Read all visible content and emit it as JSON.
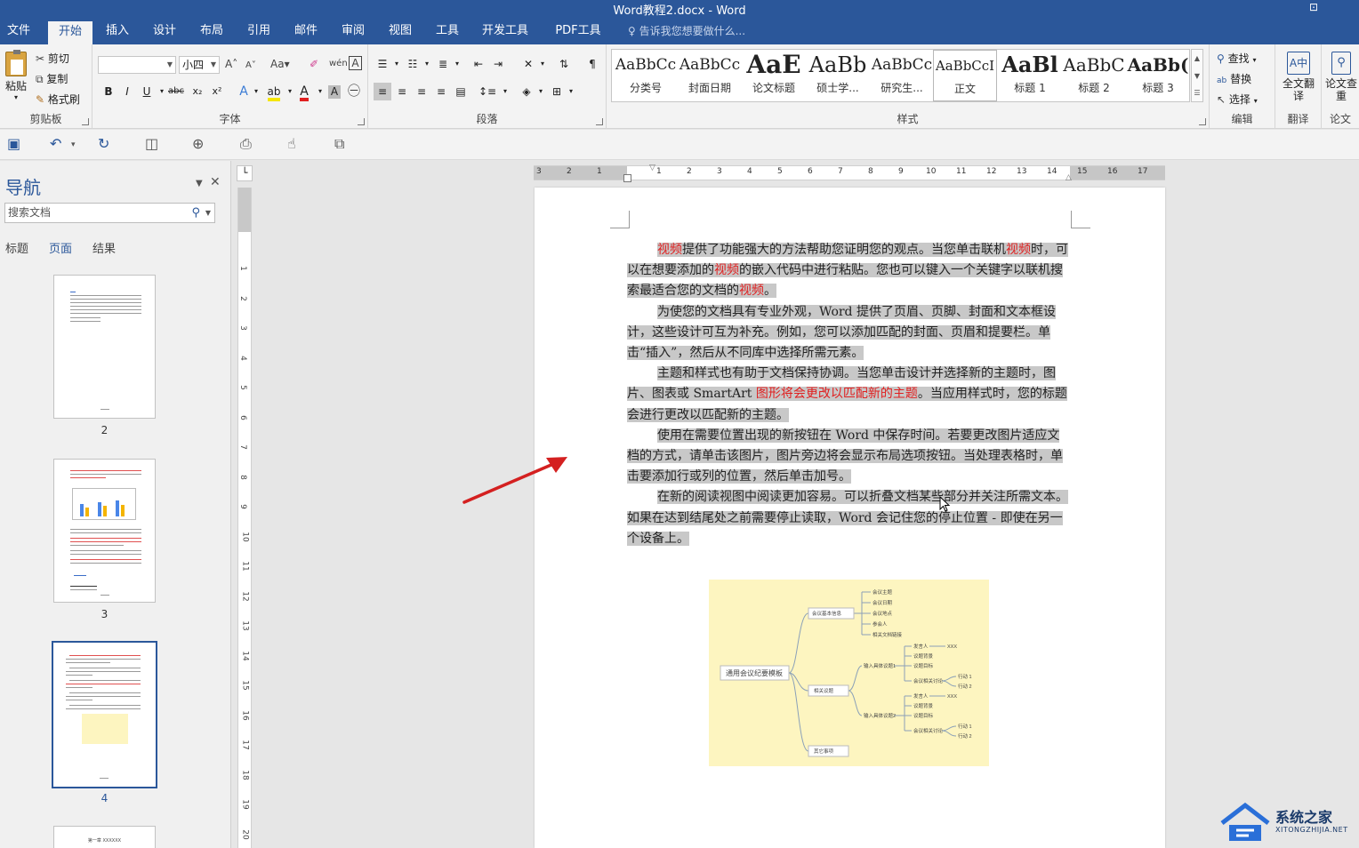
{
  "window": {
    "title": "Word教程2.docx - Word"
  },
  "menu": {
    "tabs": [
      "文件",
      "开始",
      "插入",
      "设计",
      "布局",
      "引用",
      "邮件",
      "审阅",
      "视图",
      "工具",
      "开发工具",
      "PDF工具集"
    ],
    "tell_me": "告诉我您想要做什么..."
  },
  "ribbon": {
    "clipboard": {
      "paste": "粘贴",
      "cut": "剪切",
      "copy": "复制",
      "format_painter": "格式刷",
      "label": "剪贴板"
    },
    "font": {
      "font_name": "",
      "font_size": "小四",
      "label": "字体"
    },
    "paragraph": {
      "label": "段落"
    },
    "styles": {
      "label": "样式",
      "items": [
        {
          "preview": "AaBbCc",
          "name": "分类号"
        },
        {
          "preview": "AaBbCc",
          "name": "封面日期"
        },
        {
          "preview": "AaE",
          "name": "论文标题"
        },
        {
          "preview": "AaBb",
          "name": "硕士学..."
        },
        {
          "preview": "AaBbCc",
          "name": "研究生..."
        },
        {
          "preview": "AaBbCcI",
          "name": "正文"
        },
        {
          "preview": "AaBl",
          "name": "标题 1"
        },
        {
          "preview": "AaBbC",
          "name": "标题 2"
        },
        {
          "preview": "AaBb(",
          "name": "标题 3"
        }
      ]
    },
    "editing": {
      "find": "查找",
      "replace": "替换",
      "select": "选择",
      "label": "编辑"
    },
    "translate": {
      "full": "全文翻译",
      "label": "翻译"
    },
    "paper": {
      "check": "论文查重",
      "label": "论文"
    }
  },
  "nav": {
    "title": "导航",
    "search_placeholder": "搜索文档",
    "tabs": [
      "标题",
      "页面",
      "结果"
    ],
    "pages": [
      "2",
      "3",
      "4"
    ],
    "page5_text": "第一章 XXXXXX"
  },
  "ruler": {
    "h_ticks": [
      "3",
      "2",
      "1",
      "1",
      "2",
      "3",
      "4",
      "5",
      "6",
      "7",
      "8",
      "9",
      "10",
      "11",
      "12",
      "13",
      "14",
      "15",
      "16",
      "17"
    ],
    "v_ticks": [
      "1",
      "2",
      "3",
      "4",
      "5",
      "6",
      "7",
      "8",
      "9",
      "10",
      "11",
      "12",
      "13",
      "14",
      "15",
      "16",
      "17",
      "18",
      "19",
      "20"
    ]
  },
  "doc": {
    "paragraphs": [
      [
        {
          "t": "视频",
          "red": true
        },
        {
          "t": "提供了功能强大的方法帮助您证明您的观点。当您单击联机"
        },
        {
          "t": "视频",
          "red": true
        },
        {
          "t": "时，可以在想要添加的"
        },
        {
          "t": "视频",
          "red": true
        },
        {
          "t": "的嵌入代码中进行粘贴。您也可以键入一个关键字以联机搜索最适合您的文档的"
        },
        {
          "t": "视频",
          "red": true
        },
        {
          "t": "。"
        }
      ],
      [
        {
          "t": "为使您的文档具有专业外观，Word 提供了页眉、页脚、封面和文本框设计，这些设计可互为补充。例如，您可以添加匹配的封面、页眉和提要栏。单击“插入”，然后从不同库中选择所需元素。"
        }
      ],
      [
        {
          "t": "主题和样式也有助于文档保持协调。当您单击设计并选择新的主题时，图片、图表或 SmartArt "
        },
        {
          "t": "图形将会更改以匹配新的主题",
          "red": true
        },
        {
          "t": "。当应用样式时，您的标题会进行更改以匹配新的主题。"
        }
      ],
      [
        {
          "t": "使用在需要位置出现的新按钮在 Word 中保存时间。若要更改图片适应文档的方式，请单击该图片，图片旁边将会显示布局选项按钮。当处理表格时，单击要添加行或列的位置，然后单击加号。"
        }
      ],
      [
        {
          "t": "在新的阅读视图中阅读更加容易。可以折叠文档某些部分并关注所需文本。如果在达到结尾处之前需要停止读取，Word 会记住您的停止位置 - 即使在另一个设备上。"
        }
      ]
    ]
  },
  "mindmap": {
    "root": "通用会议纪要模板",
    "branches": [
      "会议基本信息",
      "相关议题",
      "其它事项"
    ],
    "info_leaves": [
      "会议主题",
      "会议日期",
      "会议地点",
      "参会人",
      "相关文档链接"
    ],
    "topics": [
      "输入具体议题1",
      "输入具体议题2"
    ],
    "topic_leaves": [
      "发言人",
      "议题背景",
      "议题目标",
      "会议相关讨论"
    ],
    "speaker_value": "XXX",
    "actions": [
      "行动 1",
      "行动 2"
    ]
  },
  "watermark": {
    "name": "系统之家",
    "url": "XITONGZHIJIA.NET"
  }
}
